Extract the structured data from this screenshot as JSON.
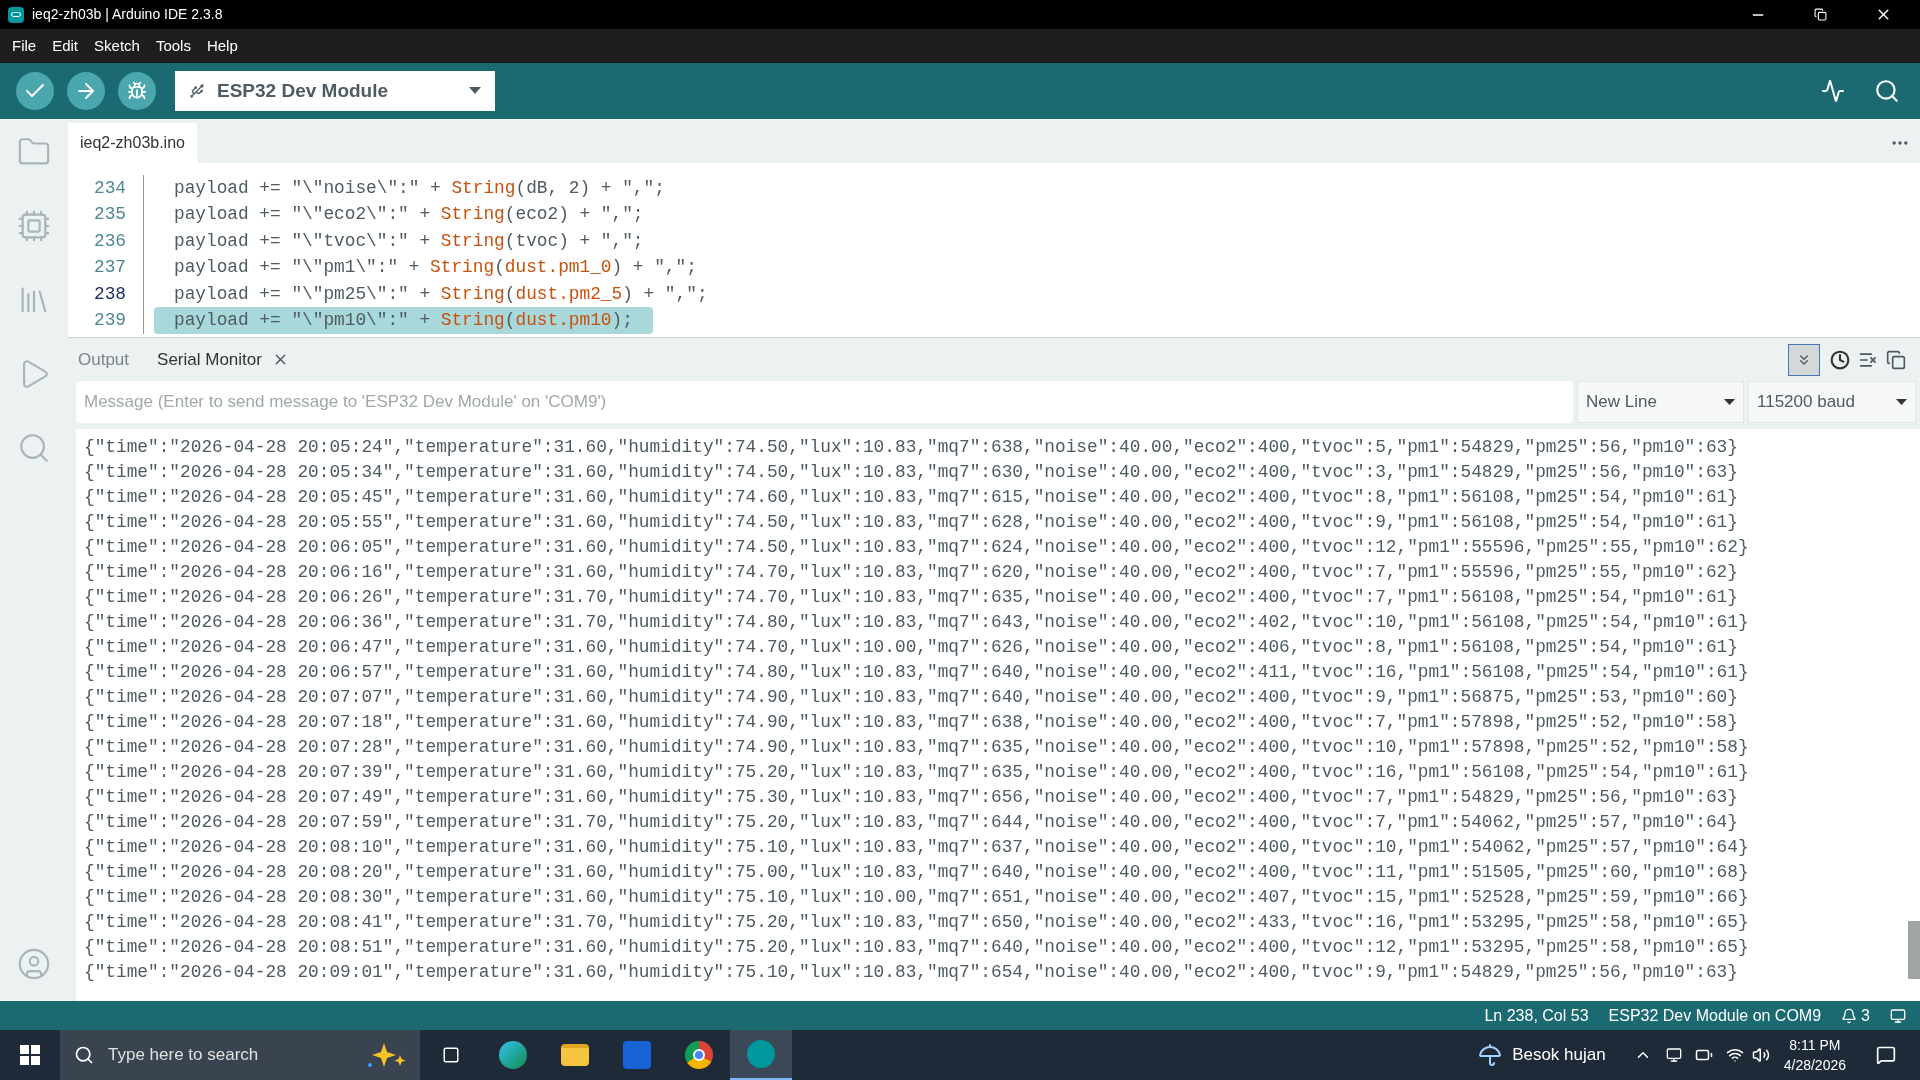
{
  "window": {
    "title": "ieq2-zh03b | Arduino IDE 2.3.8"
  },
  "menu": [
    "File",
    "Edit",
    "Sketch",
    "Tools",
    "Help"
  ],
  "toolbar": {
    "board": "ESP32 Dev Module"
  },
  "editor": {
    "tab": "ieq2-zh03b.ino",
    "lines": [
      {
        "number": "234",
        "current": false,
        "selected": false,
        "parts": [
          {
            "kind": "plain",
            "text": "payload += \"\\\"noise\\\":\" + "
          },
          {
            "kind": "call",
            "text": "String"
          },
          {
            "kind": "plain",
            "text": "(dB, 2) + \",\";"
          }
        ]
      },
      {
        "number": "235",
        "current": false,
        "selected": false,
        "parts": [
          {
            "kind": "plain",
            "text": "payload += \"\\\"eco2\\\":\" + "
          },
          {
            "kind": "call",
            "text": "String"
          },
          {
            "kind": "plain",
            "text": "(eco2) + \",\";"
          }
        ]
      },
      {
        "number": "236",
        "current": false,
        "selected": false,
        "parts": [
          {
            "kind": "plain",
            "text": "payload += \"\\\"tvoc\\\":\" + "
          },
          {
            "kind": "call",
            "text": "String"
          },
          {
            "kind": "plain",
            "text": "(tvoc) + \",\";"
          }
        ]
      },
      {
        "number": "237",
        "current": false,
        "selected": false,
        "parts": [
          {
            "kind": "plain",
            "text": "payload += \"\\\"pm1\\\":\" + "
          },
          {
            "kind": "call",
            "text": "String"
          },
          {
            "kind": "plain",
            "text": "("
          },
          {
            "kind": "call",
            "text": "dust.pm1_0"
          },
          {
            "kind": "plain",
            "text": ") + \",\";"
          }
        ]
      },
      {
        "number": "238",
        "current": true,
        "selected": false,
        "parts": [
          {
            "kind": "plain",
            "text": "payload += \"\\\"pm25\\\":\" + "
          },
          {
            "kind": "call",
            "text": "String"
          },
          {
            "kind": "plain",
            "text": "("
          },
          {
            "kind": "call",
            "text": "dust.pm2_5"
          },
          {
            "kind": "plain",
            "text": ") + \",\";"
          }
        ]
      },
      {
        "number": "239",
        "current": false,
        "selected": true,
        "parts": [
          {
            "kind": "plain",
            "text": "payload += \"\\\"pm10\\\":\" + "
          },
          {
            "kind": "call",
            "text": "String"
          },
          {
            "kind": "plain",
            "text": "("
          },
          {
            "kind": "call",
            "text": "dust.pm10"
          },
          {
            "kind": "plain",
            "text": ");"
          }
        ]
      }
    ]
  },
  "panel": {
    "tabs": [
      {
        "label": "Output",
        "selected": false,
        "closable": false
      },
      {
        "label": "Serial Monitor",
        "selected": true,
        "closable": true
      }
    ],
    "autoscroll": {
      "on": true
    },
    "message": {
      "placeholder": "Message (Enter to send message to 'ESP32 Dev Module' on 'COM9')"
    },
    "line_ending": "New Line",
    "baud": "115200 baud",
    "serial_lines": [
      "{\"time\":\"2026-04-28 20:05:24\",\"temperature\":31.60,\"humidity\":74.50,\"lux\":10.83,\"mq7\":638,\"noise\":40.00,\"eco2\":400,\"tvoc\":5,\"pm1\":54829,\"pm25\":56,\"pm10\":63}",
      "{\"time\":\"2026-04-28 20:05:34\",\"temperature\":31.60,\"humidity\":74.50,\"lux\":10.83,\"mq7\":630,\"noise\":40.00,\"eco2\":400,\"tvoc\":3,\"pm1\":54829,\"pm25\":56,\"pm10\":63}",
      "{\"time\":\"2026-04-28 20:05:45\",\"temperature\":31.60,\"humidity\":74.60,\"lux\":10.83,\"mq7\":615,\"noise\":40.00,\"eco2\":400,\"tvoc\":8,\"pm1\":56108,\"pm25\":54,\"pm10\":61}",
      "{\"time\":\"2026-04-28 20:05:55\",\"temperature\":31.60,\"humidity\":74.50,\"lux\":10.83,\"mq7\":628,\"noise\":40.00,\"eco2\":400,\"tvoc\":9,\"pm1\":56108,\"pm25\":54,\"pm10\":61}",
      "{\"time\":\"2026-04-28 20:06:05\",\"temperature\":31.60,\"humidity\":74.50,\"lux\":10.83,\"mq7\":624,\"noise\":40.00,\"eco2\":400,\"tvoc\":12,\"pm1\":55596,\"pm25\":55,\"pm10\":62}",
      "{\"time\":\"2026-04-28 20:06:16\",\"temperature\":31.60,\"humidity\":74.70,\"lux\":10.83,\"mq7\":620,\"noise\":40.00,\"eco2\":400,\"tvoc\":7,\"pm1\":55596,\"pm25\":55,\"pm10\":62}",
      "{\"time\":\"2026-04-28 20:06:26\",\"temperature\":31.70,\"humidity\":74.70,\"lux\":10.83,\"mq7\":635,\"noise\":40.00,\"eco2\":400,\"tvoc\":7,\"pm1\":56108,\"pm25\":54,\"pm10\":61}",
      "{\"time\":\"2026-04-28 20:06:36\",\"temperature\":31.70,\"humidity\":74.80,\"lux\":10.83,\"mq7\":643,\"noise\":40.00,\"eco2\":402,\"tvoc\":10,\"pm1\":56108,\"pm25\":54,\"pm10\":61}",
      "{\"time\":\"2026-04-28 20:06:47\",\"temperature\":31.60,\"humidity\":74.70,\"lux\":10.00,\"mq7\":626,\"noise\":40.00,\"eco2\":406,\"tvoc\":8,\"pm1\":56108,\"pm25\":54,\"pm10\":61}",
      "{\"time\":\"2026-04-28 20:06:57\",\"temperature\":31.60,\"humidity\":74.80,\"lux\":10.83,\"mq7\":640,\"noise\":40.00,\"eco2\":411,\"tvoc\":16,\"pm1\":56108,\"pm25\":54,\"pm10\":61}",
      "{\"time\":\"2026-04-28 20:07:07\",\"temperature\":31.60,\"humidity\":74.90,\"lux\":10.83,\"mq7\":640,\"noise\":40.00,\"eco2\":400,\"tvoc\":9,\"pm1\":56875,\"pm25\":53,\"pm10\":60}",
      "{\"time\":\"2026-04-28 20:07:18\",\"temperature\":31.60,\"humidity\":74.90,\"lux\":10.83,\"mq7\":638,\"noise\":40.00,\"eco2\":400,\"tvoc\":7,\"pm1\":57898,\"pm25\":52,\"pm10\":58}",
      "{\"time\":\"2026-04-28 20:07:28\",\"temperature\":31.60,\"humidity\":74.90,\"lux\":10.83,\"mq7\":635,\"noise\":40.00,\"eco2\":400,\"tvoc\":10,\"pm1\":57898,\"pm25\":52,\"pm10\":58}",
      "{\"time\":\"2026-04-28 20:07:39\",\"temperature\":31.60,\"humidity\":75.20,\"lux\":10.83,\"mq7\":635,\"noise\":40.00,\"eco2\":400,\"tvoc\":16,\"pm1\":56108,\"pm25\":54,\"pm10\":61}",
      "{\"time\":\"2026-04-28 20:07:49\",\"temperature\":31.60,\"humidity\":75.30,\"lux\":10.83,\"mq7\":656,\"noise\":40.00,\"eco2\":400,\"tvoc\":7,\"pm1\":54829,\"pm25\":56,\"pm10\":63}",
      "{\"time\":\"2026-04-28 20:07:59\",\"temperature\":31.70,\"humidity\":75.20,\"lux\":10.83,\"mq7\":644,\"noise\":40.00,\"eco2\":400,\"tvoc\":7,\"pm1\":54062,\"pm25\":57,\"pm10\":64}",
      "{\"time\":\"2026-04-28 20:08:10\",\"temperature\":31.60,\"humidity\":75.10,\"lux\":10.83,\"mq7\":637,\"noise\":40.00,\"eco2\":400,\"tvoc\":10,\"pm1\":54062,\"pm25\":57,\"pm10\":64}",
      "{\"time\":\"2026-04-28 20:08:20\",\"temperature\":31.60,\"humidity\":75.00,\"lux\":10.83,\"mq7\":640,\"noise\":40.00,\"eco2\":400,\"tvoc\":11,\"pm1\":51505,\"pm25\":60,\"pm10\":68}",
      "{\"time\":\"2026-04-28 20:08:30\",\"temperature\":31.60,\"humidity\":75.10,\"lux\":10.00,\"mq7\":651,\"noise\":40.00,\"eco2\":407,\"tvoc\":15,\"pm1\":52528,\"pm25\":59,\"pm10\":66}",
      "{\"time\":\"2026-04-28 20:08:41\",\"temperature\":31.70,\"humidity\":75.20,\"lux\":10.83,\"mq7\":650,\"noise\":40.00,\"eco2\":433,\"tvoc\":16,\"pm1\":53295,\"pm25\":58,\"pm10\":65}",
      "{\"time\":\"2026-04-28 20:08:51\",\"temperature\":31.60,\"humidity\":75.20,\"lux\":10.83,\"mq7\":640,\"noise\":40.00,\"eco2\":400,\"tvoc\":12,\"pm1\":53295,\"pm25\":58,\"pm10\":65}",
      "{\"time\":\"2026-04-28 20:09:01\",\"temperature\":31.60,\"humidity\":75.10,\"lux\":10.83,\"mq7\":654,\"noise\":40.00,\"eco2\":400,\"tvoc\":9,\"pm1\":54829,\"pm25\":56,\"pm10\":63}"
    ]
  },
  "status_bar": {
    "position": "Ln 238, Col 53",
    "board": "ESP32 Dev Module on COM9",
    "notifications": "3"
  },
  "taskbar": {
    "search": {
      "placeholder": "Type here to search"
    },
    "weather": "Besok hujan",
    "time": "8:11 PM",
    "date": "4/28/2026"
  }
}
